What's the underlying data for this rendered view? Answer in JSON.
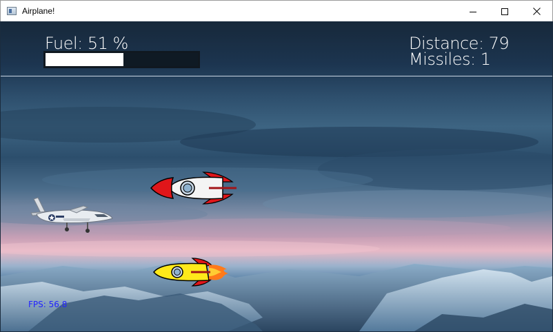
{
  "window": {
    "title": "Airplane!",
    "minimize_icon": "minimize-icon",
    "maximize_icon": "maximize-icon",
    "close_icon": "close-icon"
  },
  "hud": {
    "fuel_label": "Fuel: 51 %",
    "fuel_level": 0.51,
    "distance_label": "Distance: 79",
    "missiles_label": "Missiles:   1",
    "fps_label": "FPS:  56.8"
  },
  "sprites": {
    "player": "player-airplane",
    "enemy_missile": "red-white-rocket",
    "player_missile": "yellow-rocket-with-flame"
  },
  "colors": {
    "fuel_fill": "#ffffff",
    "fps_text": "#2222ff",
    "hud_text": "#ffffff"
  }
}
